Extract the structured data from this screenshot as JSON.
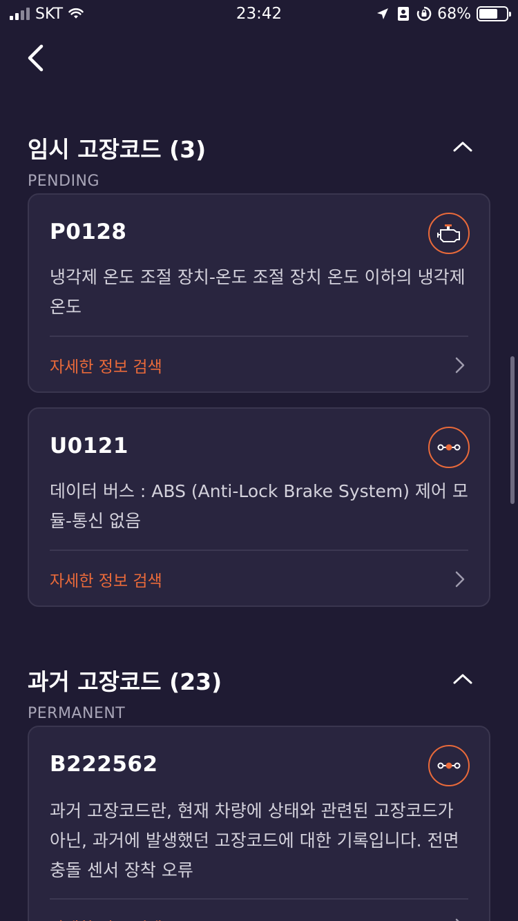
{
  "status_bar": {
    "carrier": "SKT",
    "time": "23:42",
    "battery_percent": "68%",
    "battery_level": 0.68
  },
  "pending_section": {
    "title": "임시 고장코드 (3)",
    "subtitle": "PENDING",
    "cards": [
      {
        "code": "P0128",
        "icon": "engine-icon",
        "description": "냉각제 온도 조절 장치-온도 조절 장치 온도 이하의 냉각제 온도",
        "link_label": "자세한 정보 검색"
      },
      {
        "code": "U0121",
        "icon": "network-bus-icon",
        "description": "데이터 버스 : ABS (Anti-Lock Brake System) 제어 모듈-통신 없음",
        "link_label": "자세한 정보 검색"
      }
    ]
  },
  "permanent_section": {
    "title": "과거 고장코드 (23)",
    "subtitle": "PERMANENT",
    "cards": [
      {
        "code": "B222562",
        "icon": "network-bus-icon",
        "description": "과거 고장코드란, 현재 차량에 상태와 관련된 고장코드가 아닌, 과거에 발생했던 고장코드에 대한 기록입니다. 전면 충돌 센서 장착 오류",
        "link_label": "자세한 정보 검색"
      }
    ]
  },
  "colors": {
    "background": "#1f1b33",
    "card": "#29253f",
    "accent": "#ea6a3a"
  }
}
